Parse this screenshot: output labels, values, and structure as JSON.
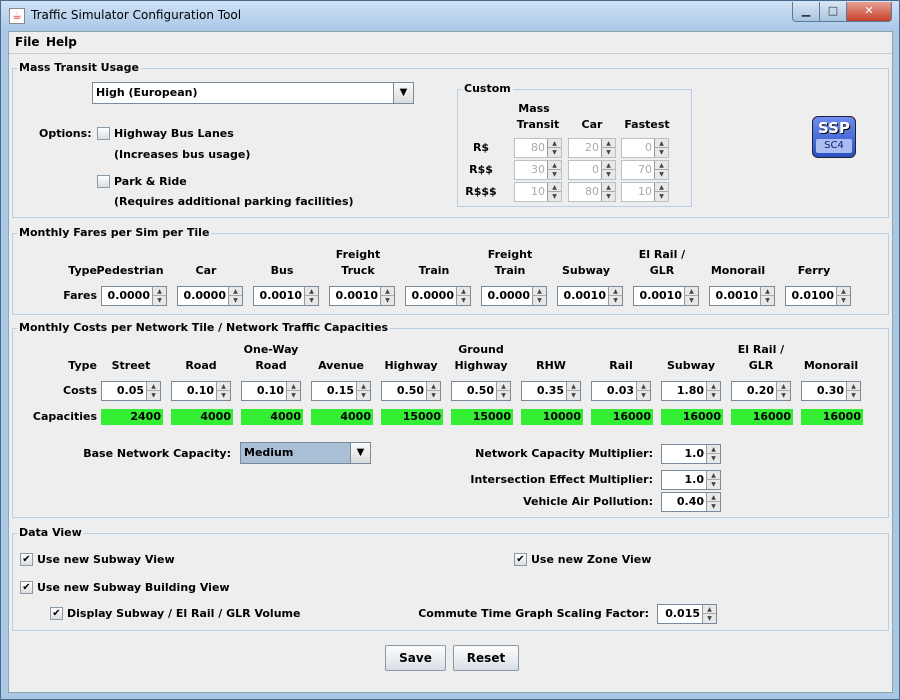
{
  "window": {
    "title": "Traffic Simulator Configuration Tool",
    "minimize": "▁",
    "maximize": "□",
    "close": "✕"
  },
  "menu": {
    "file": "File",
    "help": "Help"
  },
  "mass_transit": {
    "title": "Mass Transit Usage",
    "selected": "High (European)",
    "options_label": "Options:",
    "highway_bus_lanes": {
      "label": "Highway Bus Lanes",
      "note": "(Increases bus usage)",
      "checked": false
    },
    "park_ride": {
      "label": "Park & Ride",
      "note": "(Requires additional parking facilities)",
      "checked": false
    },
    "custom": {
      "title": "Custom",
      "col_mass": "Mass",
      "col_transit": "Transit",
      "col_car": "Car",
      "col_fastest": "Fastest",
      "rows": [
        {
          "label": "R$",
          "mass": "80",
          "car": "20",
          "fastest": "0"
        },
        {
          "label": "R$$",
          "mass": "30",
          "car": "0",
          "fastest": "70"
        },
        {
          "label": "R$$$",
          "mass": "10",
          "car": "80",
          "fastest": "10"
        }
      ]
    }
  },
  "logo": {
    "line1": "SSP",
    "line2": "SC4"
  },
  "fares": {
    "title": "Monthly Fares per Sim per Tile",
    "type_label": "Type",
    "row_label": "Fares",
    "columns": [
      {
        "h1": "",
        "h2": "Pedestrian",
        "value": "0.0000"
      },
      {
        "h1": "",
        "h2": "Car",
        "value": "0.0000"
      },
      {
        "h1": "",
        "h2": "Bus",
        "value": "0.0010"
      },
      {
        "h1": "Freight",
        "h2": "Truck",
        "value": "0.0010"
      },
      {
        "h1": "",
        "h2": "Train",
        "value": "0.0000"
      },
      {
        "h1": "Freight",
        "h2": "Train",
        "value": "0.0000"
      },
      {
        "h1": "",
        "h2": "Subway",
        "value": "0.0010"
      },
      {
        "h1": "El Rail /",
        "h2": "GLR",
        "value": "0.0010"
      },
      {
        "h1": "",
        "h2": "Monorail",
        "value": "0.0010"
      },
      {
        "h1": "",
        "h2": "Ferry",
        "value": "0.0100"
      }
    ]
  },
  "costs": {
    "title": "Monthly Costs per Network Tile / Network Traffic Capacities",
    "type_label": "Type",
    "costs_label": "Costs",
    "capacities_label": "Capacities",
    "columns": [
      {
        "h1": "",
        "h2": "Street",
        "cost": "0.05",
        "capacity": "2400"
      },
      {
        "h1": "",
        "h2": "Road",
        "cost": "0.10",
        "capacity": "4000"
      },
      {
        "h1": "One-Way",
        "h2": "Road",
        "cost": "0.10",
        "capacity": "4000"
      },
      {
        "h1": "",
        "h2": "Avenue",
        "cost": "0.15",
        "capacity": "4000"
      },
      {
        "h1": "",
        "h2": "Highway",
        "cost": "0.50",
        "capacity": "15000"
      },
      {
        "h1": "Ground",
        "h2": "Highway",
        "cost": "0.50",
        "capacity": "15000"
      },
      {
        "h1": "",
        "h2": "RHW",
        "cost": "0.35",
        "capacity": "10000"
      },
      {
        "h1": "",
        "h2": "Rail",
        "cost": "0.03",
        "capacity": "16000"
      },
      {
        "h1": "",
        "h2": "Subway",
        "cost": "1.80",
        "capacity": "16000"
      },
      {
        "h1": "El Rail /",
        "h2": "GLR",
        "cost": "0.20",
        "capacity": "16000"
      },
      {
        "h1": "",
        "h2": "Monorail",
        "cost": "0.30",
        "capacity": "16000"
      }
    ],
    "base_capacity_label": "Base Network Capacity:",
    "base_capacity_value": "Medium",
    "network_multiplier_label": "Network Capacity Multiplier:",
    "network_multiplier": "1.0",
    "intersection_label": "Intersection Effect Multiplier:",
    "intersection": "1.0",
    "pollution_label": "Vehicle Air Pollution:",
    "pollution": "0.40"
  },
  "data_view": {
    "title": "Data View",
    "subway_view": {
      "label": "Use new Subway View",
      "checked": true
    },
    "zone_view": {
      "label": "Use new Zone View",
      "checked": true
    },
    "subway_building_view": {
      "label": "Use new Subway Building View",
      "checked": true
    },
    "display_volume": {
      "label": "Display Subway / El Rail / GLR Volume",
      "checked": true
    },
    "scaling_label": "Commute Time Graph Scaling Factor:",
    "scaling_value": "0.015"
  },
  "buttons": {
    "save": "Save",
    "reset": "Reset"
  },
  "colors": {
    "capacity_fill": "#33ee33",
    "accent_border": "#b8cfe5"
  }
}
